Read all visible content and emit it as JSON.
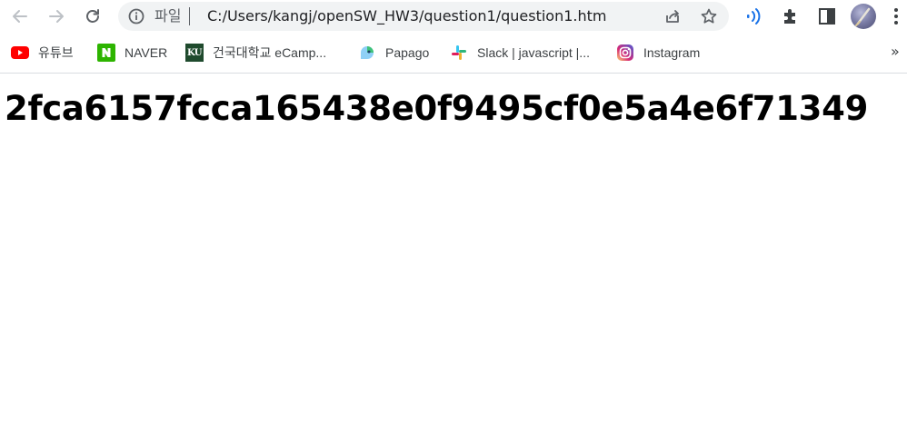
{
  "browser": {
    "address_bar": {
      "scheme_label": "파일",
      "url": "C:/Users/kangj/openSW_HW3/question1/question1.htm"
    },
    "nav_icons": [
      "back-arrow-icon",
      "forward-arrow-icon",
      "reload-icon"
    ],
    "toolbar_icons": [
      "info-icon",
      "share-icon",
      "star-icon",
      "read-aloud-icon",
      "extensions-icon",
      "side-panel-icon",
      "profile-avatar",
      "more-vert-icon"
    ]
  },
  "bookmarks": {
    "items": [
      {
        "label": "유튜브",
        "icon": "youtube-icon"
      },
      {
        "label": "NAVER",
        "icon": "naver-icon"
      },
      {
        "label": "건국대학교 eCamp...",
        "icon": "ku-icon",
        "icon_text": "KU"
      },
      {
        "label": "Papago",
        "icon": "papago-icon"
      },
      {
        "label": "Slack | javascript |...",
        "icon": "slack-icon"
      },
      {
        "label": "Instagram",
        "icon": "instagram-icon"
      }
    ],
    "overflow_label": "»"
  },
  "page": {
    "heading": "2fca6157fcca165438e0f9495cf0e5a4e6f71349"
  },
  "colors": {
    "omnibox_bg": "#f1f3f4",
    "youtube_red": "#ff0000",
    "naver_green": "#2db400",
    "ku_green": "#1f4a2d",
    "read_aloud_blue": "#1a73e8"
  }
}
